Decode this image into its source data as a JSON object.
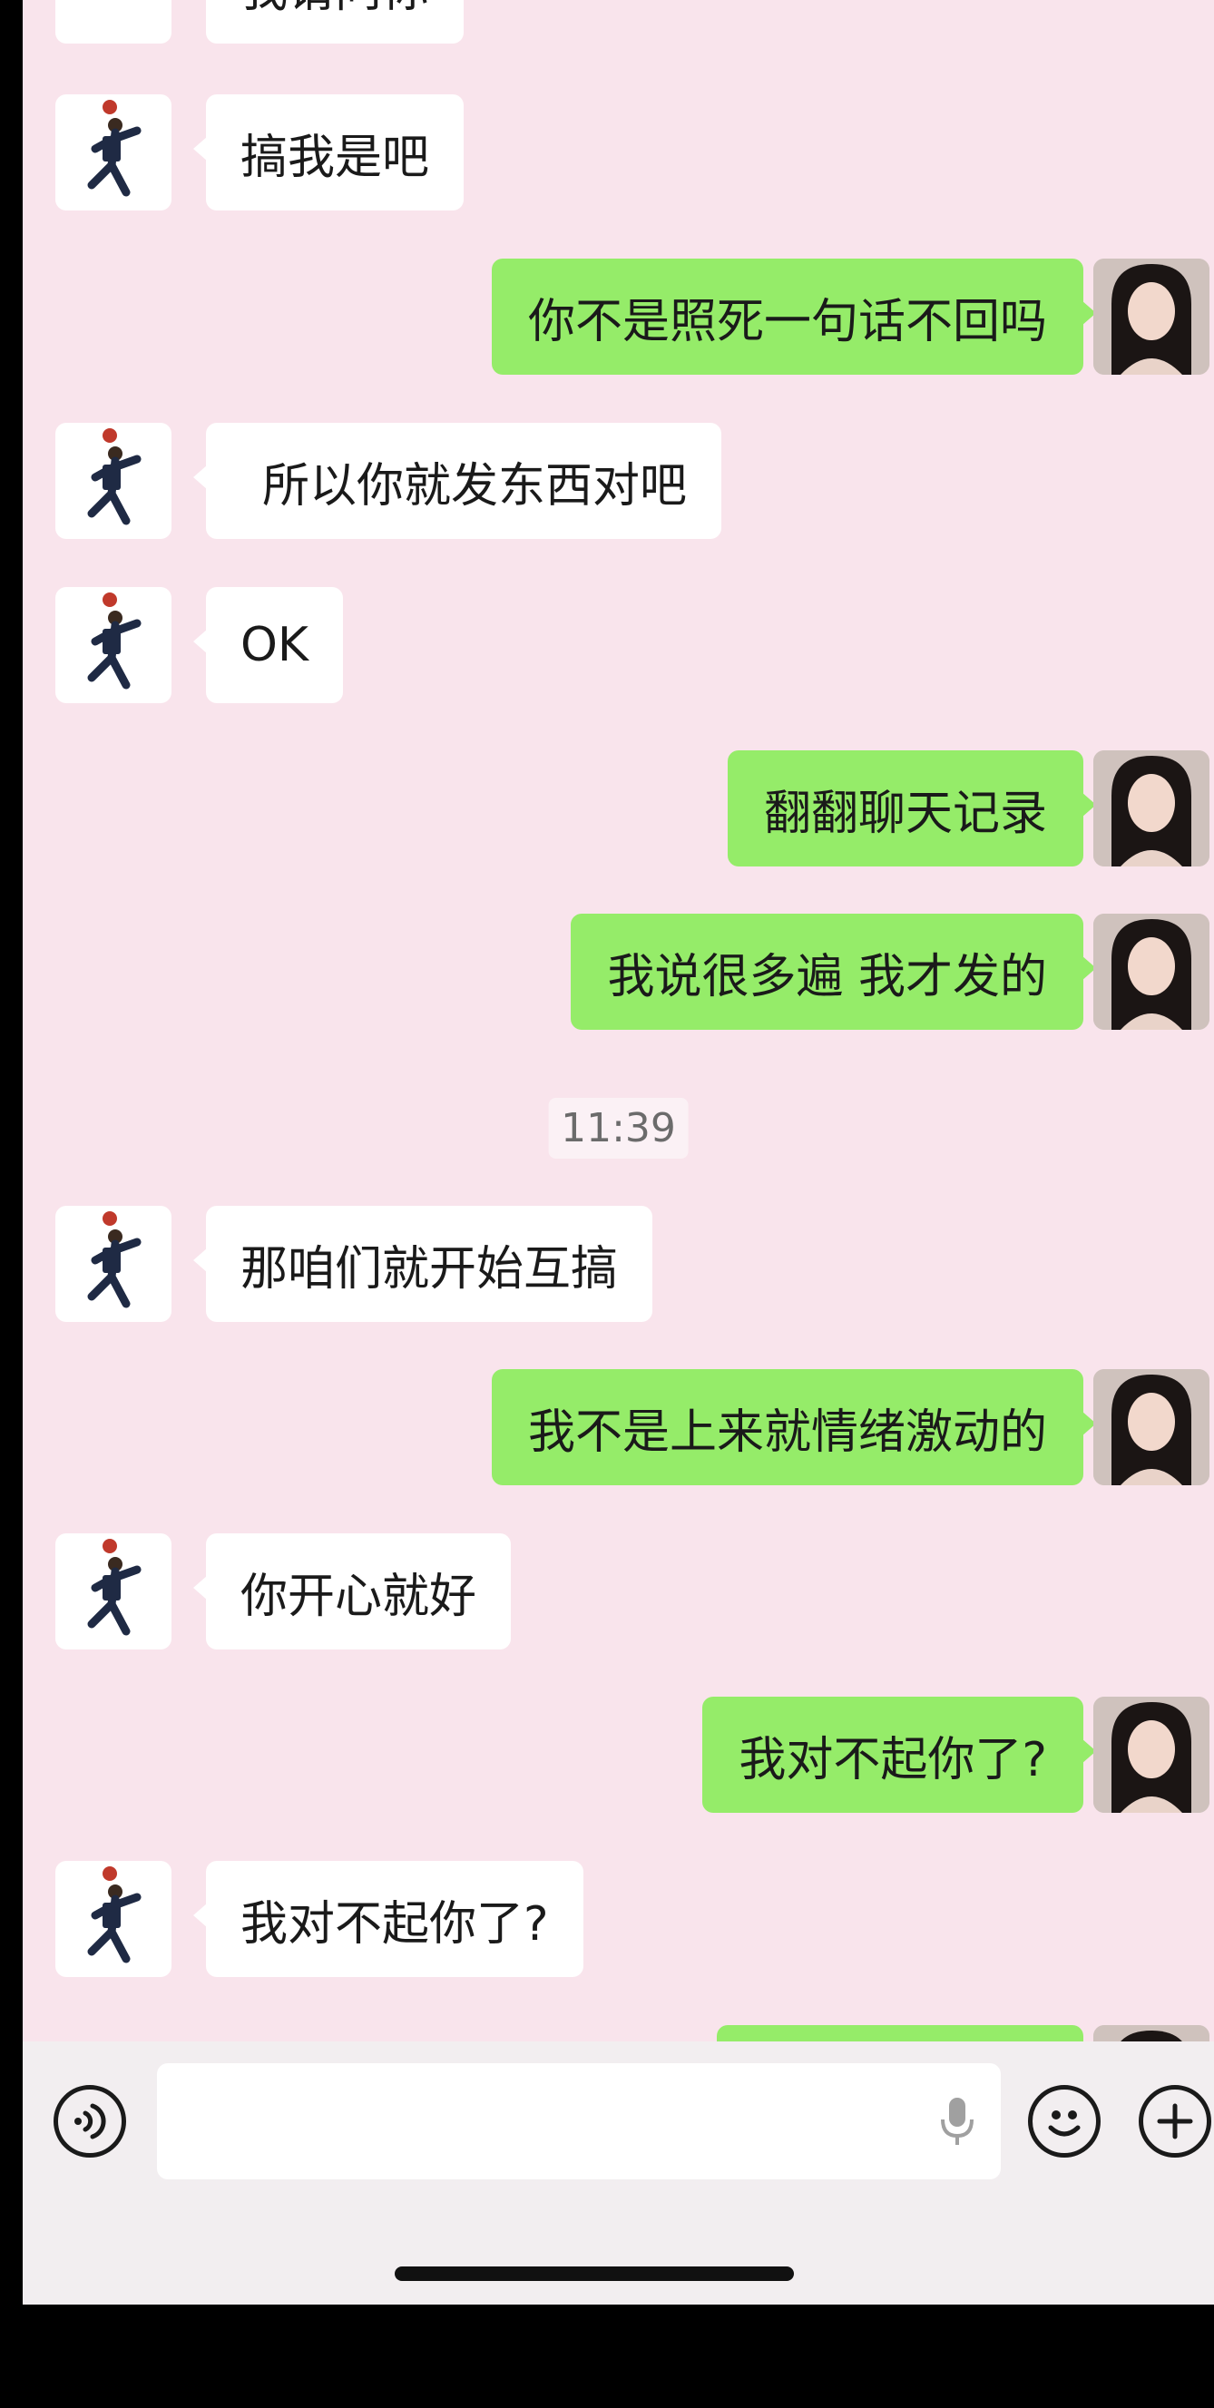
{
  "messages": [
    {
      "side": "left",
      "text": "我请问你"
    },
    {
      "side": "left",
      "text": "搞我是吧"
    },
    {
      "side": "right",
      "text": "你不是照死一句话不回吗"
    },
    {
      "side": "left",
      "text": "所以你就发东西对吧"
    },
    {
      "side": "left",
      "text": "OK"
    },
    {
      "side": "right",
      "text": "翻翻聊天记录"
    },
    {
      "side": "right",
      "text": "我说很多遍 我才发的"
    },
    {
      "side": "left",
      "text": "那咱们就开始互搞"
    },
    {
      "side": "right",
      "text": "我不是上来就情绪激动的"
    },
    {
      "side": "left",
      "text": "你开心就好"
    },
    {
      "side": "right",
      "text": "我对不起你了?"
    },
    {
      "side": "left",
      "text": "我对不起你了?"
    }
  ],
  "timestamp": "11:39",
  "input": {
    "value": "",
    "voice_icon": "voice-toggle-icon",
    "mic_icon": "microphone-icon",
    "emoji_icon": "emoji-icon",
    "plus_icon": "plus-icon"
  },
  "colors": {
    "chat_background": "#f9e4ec",
    "sent_bubble": "#95ec69",
    "received_bubble": "#ffffff"
  }
}
